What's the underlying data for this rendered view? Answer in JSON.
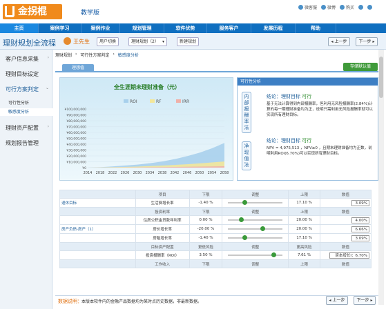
{
  "header": {
    "logo_text": "金拐棍",
    "edition": "教学版",
    "links": [
      "微客服",
      "微博",
      "购买",
      "",
      ""
    ]
  },
  "nav": {
    "items": [
      "主页",
      "案例学习",
      "案例作业",
      "规划管理",
      "软件优势",
      "服务客户",
      "发展历程",
      "帮助"
    ]
  },
  "titlebar": {
    "title": "理财规划全流程",
    "user": "王先生",
    "switch_user": "用户切换",
    "plan_select": "理财规划（2）",
    "new_plan": "新建规划",
    "prev": "上一步",
    "next": "下一步"
  },
  "sidebar": {
    "items": [
      {
        "label": "客户信息采集"
      },
      {
        "label": "理财目标设定"
      },
      {
        "label": "可行方案判定"
      },
      {
        "label": "理财资产配置"
      },
      {
        "label": "规划报告管理"
      }
    ],
    "sub": [
      "可行性分析",
      "敏感度分析"
    ]
  },
  "breadcrumb": [
    "理财规划",
    "可行性方案判定",
    "敏感度分析"
  ],
  "tab": "理想值",
  "save": "存储默认值",
  "chart_data": {
    "type": "area",
    "title": "全生涯期未理财准备（元）",
    "legend": [
      "ROI",
      "RF",
      "IRR"
    ],
    "yticks": [
      "¥100,000,000",
      "¥90,000,000",
      "¥80,000,000",
      "¥70,000,000",
      "¥60,000,000",
      "¥50,000,000",
      "¥40,000,000",
      "¥30,000,000",
      "¥20,000,000",
      "¥10,000,000",
      "¥0"
    ],
    "x": [
      "2014",
      "2018",
      "2022",
      "2026",
      "2030",
      "2034",
      "2038",
      "2042",
      "2046",
      "2050",
      "2054",
      "2058"
    ],
    "ylim": [
      0,
      100000000
    ],
    "colors": {
      "ROI": "#a8d0ec",
      "RF": "#f3e79a",
      "IRR": "#f0b0a8"
    },
    "series": [
      {
        "name": "ROI",
        "values": [
          0,
          800000,
          2000000,
          3500000,
          5200000,
          7500000,
          10500000,
          14500000,
          19500000,
          25500000,
          33000000,
          42000000
        ]
      },
      {
        "name": "RF",
        "values": [
          0,
          300000,
          700000,
          1200000,
          1800000,
          2600000,
          3500000,
          4600000,
          5800000,
          7200000,
          8800000,
          10500000
        ]
      },
      {
        "name": "IRR",
        "values": [
          0,
          100000,
          200000,
          350000,
          500000,
          700000,
          900000,
          1150000,
          1400000,
          1700000,
          2000000,
          2400000
        ]
      }
    ]
  },
  "analysis": {
    "head": "可行性分析",
    "irr": {
      "label": "内部报酬率法",
      "title": "结论：理财目标",
      "status": "可行",
      "text": "基于无法计算得到内部报酬率，但利用无风险报酬率(2.84%)计算的每一期理财准备均为正，说明只需利用无风险报酬率就可以实现所有理财目标。"
    },
    "npv": {
      "label": "净现值法",
      "title": "结论：理财目标",
      "status": "可行",
      "text": "NPV = 4,975,513 ，NPV≥0 ，且期末理财准备均为正数，说明利用ROI(6.70%)可以实现所有理财目标。"
    }
  },
  "table": {
    "rows": [
      {
        "type": "head",
        "cells": [
          "",
          "项目",
          "下限",
          "调整",
          "上限",
          "数值"
        ]
      },
      {
        "type": "row",
        "group": "退休目标",
        "item": "生活费增长率",
        "low": "-1.40 %",
        "high": "17.10 %",
        "value": "3.09%",
        "pos": 0.26
      },
      {
        "type": "head",
        "cells": [
          "",
          "投资利率",
          "下限",
          "调整",
          "上限",
          "数值"
        ]
      },
      {
        "type": "row",
        "group": "",
        "item": "住房公积金贷款年利率",
        "low": "0.00 %",
        "high": "20.00 %",
        "value": "4.00%",
        "pos": 0.2
      },
      {
        "type": "row",
        "group": "房产负债-房产（1）",
        "item": "房价增长率",
        "low": "-20.00 %",
        "high": "20.00 %",
        "value": "6.66%",
        "pos": 0.58
      },
      {
        "type": "row",
        "group": "",
        "item": "房租增长率",
        "low": "-1.40 %",
        "high": "17.10 %",
        "value": "3.09%",
        "pos": 0.26
      },
      {
        "type": "head",
        "cells": [
          "",
          "目标资产配置",
          "更低风险",
          "调整",
          "更高风险",
          "数值"
        ]
      },
      {
        "type": "row",
        "group": "",
        "item": "投资报酬率（ROI）",
        "low": "3.50 %",
        "high": "7.61 %",
        "value": "资本增长Ⅰ：6.70%",
        "pos": 0.78,
        "select": true
      },
      {
        "type": "head",
        "cells": [
          "",
          "工作收入",
          "下限",
          "调整",
          "上限",
          "数值"
        ]
      }
    ]
  },
  "footer": {
    "label": "数据说明：",
    "text": "本版本软件内的金融产品数据均为某时点历史数据，非最新数据。",
    "prev": "上一步",
    "next": "下一步"
  }
}
